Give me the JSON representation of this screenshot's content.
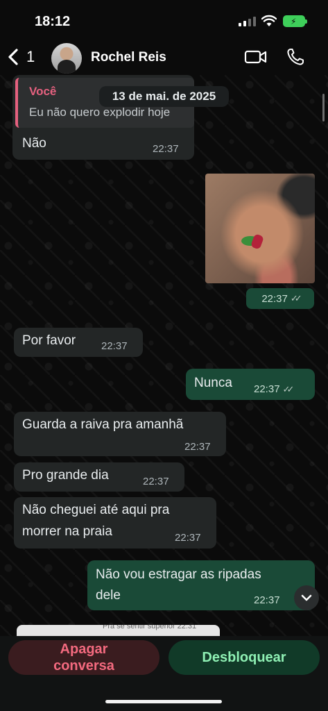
{
  "status_bar": {
    "time": "18:12"
  },
  "header": {
    "back_count": "1",
    "contact_name": "Rochel Reis"
  },
  "reply": {
    "author": "Você",
    "quoted_text": "Eu não quero explodir hoje",
    "date_separator": "13 de mai. de 2025"
  },
  "messages": [
    {
      "dir": "in",
      "text": "Não",
      "time": "22:37"
    },
    {
      "dir": "out",
      "type": "image",
      "time": "22:37"
    },
    {
      "dir": "in",
      "text": "Por favor",
      "time": "22:37"
    },
    {
      "dir": "out",
      "text": "Nunca",
      "time": "22:37"
    },
    {
      "dir": "in",
      "text": "Guarda a raiva pra amanhã",
      "time": "22:37"
    },
    {
      "dir": "in",
      "text": "Pro grande dia",
      "time": "22:37"
    },
    {
      "dir": "in",
      "line1": "Não cheguei até aqui pra",
      "line2": "morrer na praia",
      "time": "22:37"
    },
    {
      "dir": "out",
      "line1": "Não vou estragar as ripadas",
      "line2": "dele",
      "time": "22:37"
    }
  ],
  "peek": {
    "text": "Pra se sentir superior",
    "time": "22:31"
  },
  "actions": {
    "delete_line1": "Apagar",
    "delete_line2": "conversa",
    "unblock": "Desbloquear"
  },
  "colors": {
    "incoming_bubble": "#232626",
    "outgoing_bubble": "#1a4a37",
    "reply_accent": "#e5617f",
    "battery": "#3ecf5a"
  },
  "icons": [
    "chevron-left-icon",
    "video-camera-icon",
    "phone-icon",
    "chevron-down-icon",
    "read-ticks-icon",
    "wifi-icon",
    "battery-icon",
    "signal-icon"
  ]
}
